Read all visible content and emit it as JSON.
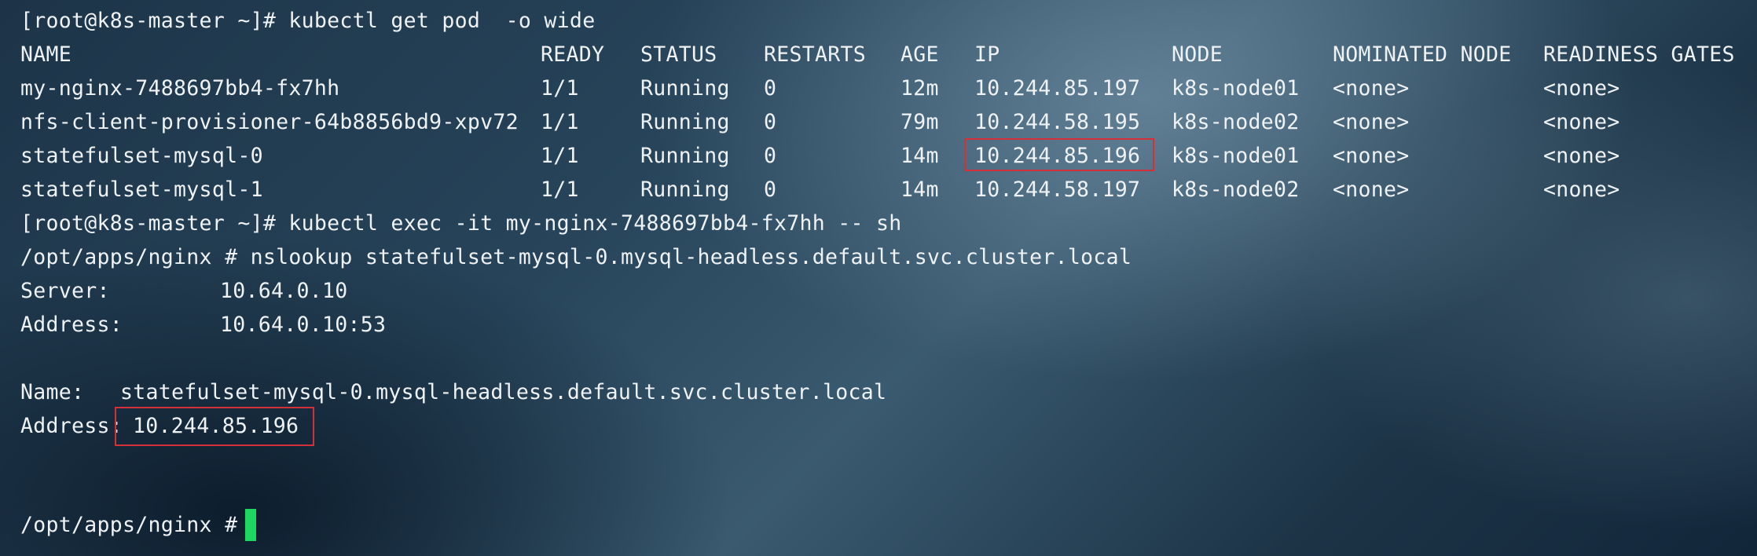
{
  "prompt_1": "[root@k8s-master ~]# kubectl get pod  -o wide",
  "table": {
    "headers": [
      "NAME",
      "READY",
      "STATUS",
      "RESTARTS",
      "AGE",
      "IP",
      "NODE",
      "NOMINATED NODE",
      "READINESS GATES"
    ],
    "rows": [
      [
        "my-nginx-7488697bb4-fx7hh",
        "1/1",
        "Running",
        "0",
        "12m",
        "10.244.85.197",
        "k8s-node01",
        "<none>",
        "<none>"
      ],
      [
        "nfs-client-provisioner-64b8856bd9-xpv72",
        "1/1",
        "Running",
        "0",
        "79m",
        "10.244.58.195",
        "k8s-node02",
        "<none>",
        "<none>"
      ],
      [
        "statefulset-mysql-0",
        "1/1",
        "Running",
        "0",
        "14m",
        "10.244.85.196",
        "k8s-node01",
        "<none>",
        "<none>"
      ],
      [
        "statefulset-mysql-1",
        "1/1",
        "Running",
        "0",
        "14m",
        "10.244.58.197",
        "k8s-node02",
        "<none>",
        "<none>"
      ]
    ]
  },
  "prompt_2": "[root@k8s-master ~]# kubectl exec -it my-nginx-7488697bb4-fx7hh -- sh",
  "prompt_3": "/opt/apps/nginx # nslookup statefulset-mysql-0.mysql-headless.default.svc.cluster.local",
  "server": {
    "label": "Server:",
    "value": "10.64.0.10"
  },
  "address_1": {
    "label": "Address:",
    "value": "10.64.0.10:53"
  },
  "name": {
    "label": "Name:",
    "value": "statefulset-mysql-0.mysql-headless.default.svc.cluster.local"
  },
  "address_2": {
    "label": "Address:",
    "value": "10.244.85.196"
  },
  "prompt_4": "/opt/apps/nginx # ",
  "colors": {
    "text": "#eef2f5",
    "highlight_box": "#d4303a",
    "cursor": "#1ed760"
  }
}
